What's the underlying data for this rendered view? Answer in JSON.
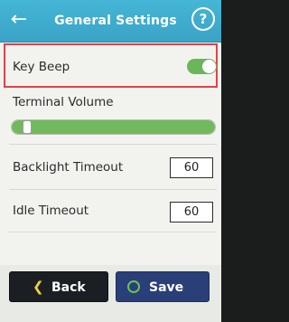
{
  "header": {
    "title": "General Settings",
    "back_icon": "arrow-left-icon",
    "help_label": "?"
  },
  "settings": {
    "key_beep": {
      "label": "Key Beep",
      "enabled": true
    },
    "terminal_volume": {
      "label": "Terminal Volume",
      "level_percent": 5
    },
    "backlight_timeout": {
      "label": "Backlight Timeout",
      "value": "60"
    },
    "idle_timeout": {
      "label": "Idle Timeout",
      "value": "60"
    }
  },
  "footer": {
    "back_label": "Back",
    "save_label": "Save",
    "back_icon": "chevron-left-icon",
    "save_icon": "circle-icon"
  },
  "colors": {
    "header": "#3aa3c6",
    "highlight": "#e0434b",
    "toggle_on": "#6cb65a",
    "back_button": "#1b1f24",
    "save_button": "#2a3e78",
    "chevron": "#f2d23b",
    "save_ring": "#66c44f"
  }
}
